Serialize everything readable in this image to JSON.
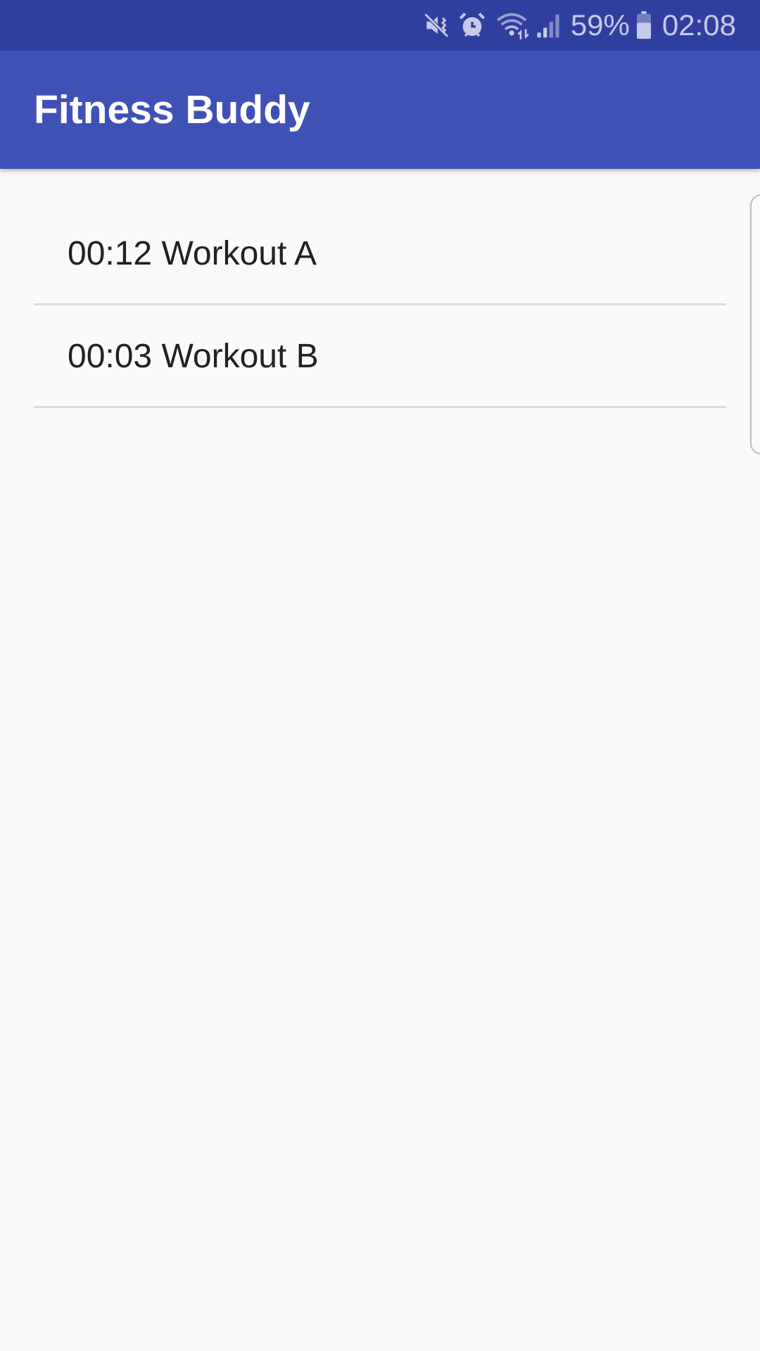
{
  "status_bar": {
    "icons": [
      "mute-vibrate-icon",
      "alarm-icon",
      "wifi-icon",
      "signal-icon",
      "battery-icon"
    ],
    "battery_percent": "59%",
    "time": "02:08",
    "colors": {
      "background": "#303F9F",
      "foreground": "#C5CAE9"
    }
  },
  "toolbar": {
    "title": "Fitness Buddy",
    "colors": {
      "background": "#3F51B5",
      "title": "#FFFFFF"
    }
  },
  "workouts": [
    {
      "label": "00:12 Workout A"
    },
    {
      "label": "00:03 Workout B"
    }
  ],
  "colors": {
    "page_background": "#FAFAFA",
    "item_text": "#212121",
    "divider": "#DADADA"
  }
}
